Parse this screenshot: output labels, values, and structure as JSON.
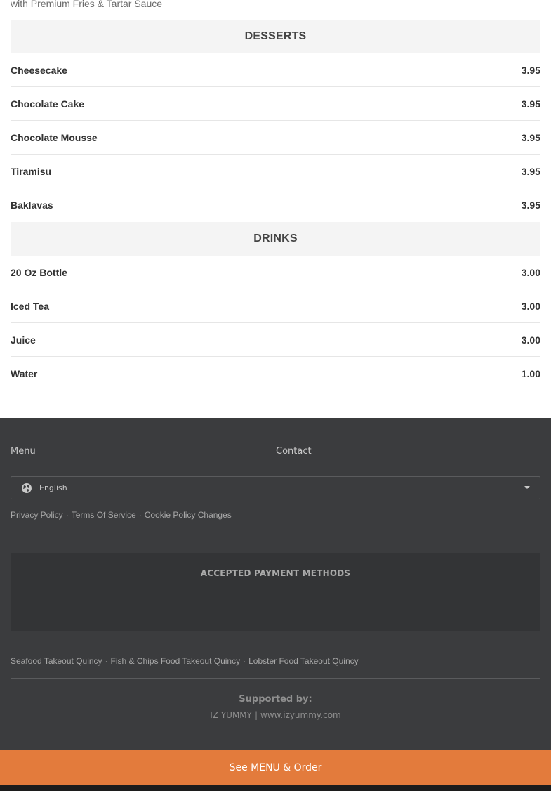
{
  "top_note": "with Premium Fries & Tartar Sauce",
  "sections": [
    {
      "title": "DESSERTS",
      "items": [
        {
          "name": "Cheesecake",
          "price": "3.95"
        },
        {
          "name": "Chocolate Cake",
          "price": "3.95"
        },
        {
          "name": "Chocolate Mousse",
          "price": "3.95"
        },
        {
          "name": "Tiramisu",
          "price": "3.95"
        },
        {
          "name": "Baklavas",
          "price": "3.95"
        }
      ]
    },
    {
      "title": "DRINKS",
      "items": [
        {
          "name": "20 Oz Bottle",
          "price": "3.00"
        },
        {
          "name": "Iced Tea",
          "price": "3.00"
        },
        {
          "name": "Juice",
          "price": "3.00"
        },
        {
          "name": "Water",
          "price": "1.00"
        }
      ]
    }
  ],
  "footer": {
    "menu_link": "Menu",
    "contact_link": "Contact",
    "language": {
      "selected": "English",
      "icon": "globe-icon"
    },
    "policy_links": [
      "Privacy Policy",
      "Terms Of Service",
      "Cookie Policy Changes"
    ],
    "payment_title": "ACCEPTED PAYMENT METHODS",
    "seo_links": [
      "Seafood Takeout Quincy",
      "Fish & Chips Food Takeout Quincy",
      "Lobster Food Takeout Quincy"
    ],
    "supported_label": "Supported by:",
    "supported_name": "IZ YUMMY",
    "supported_url": "www.izyummy.com"
  },
  "order_button": "See MENU & Order",
  "colors": {
    "footer_bg": "#3b3c3e",
    "accent": "#e37b3c",
    "section_header_bg": "#f4f4f4"
  }
}
